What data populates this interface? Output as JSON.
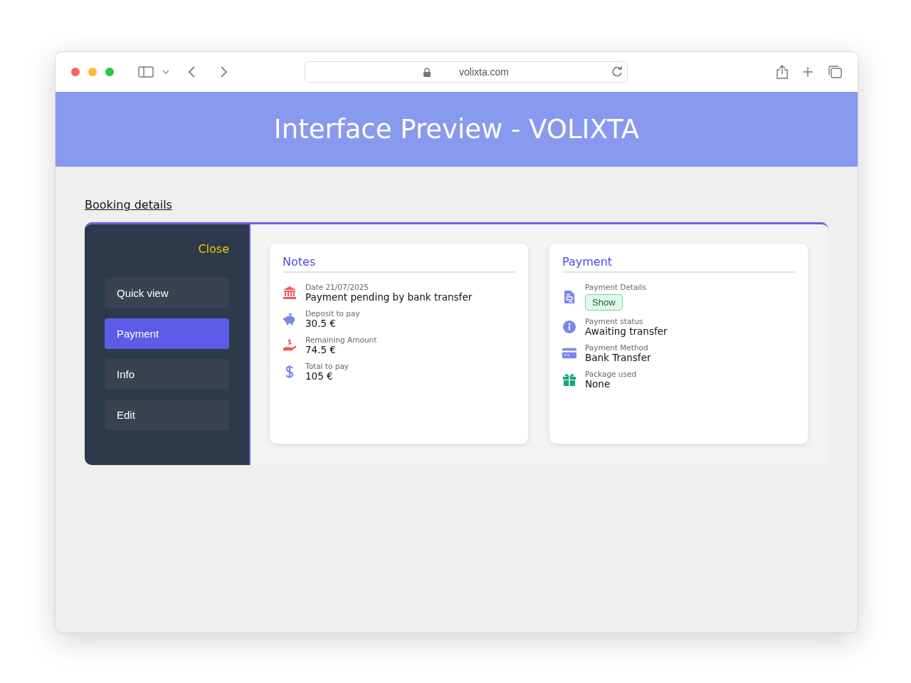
{
  "browser": {
    "url": "volixta.com"
  },
  "header": {
    "title": "Interface Preview - VOLIXTA"
  },
  "link": "Booking details",
  "sidebar": {
    "close": "Close",
    "items": [
      {
        "label": "Quick view",
        "selected": false
      },
      {
        "label": "Payment",
        "selected": true
      },
      {
        "label": "Info",
        "selected": false
      },
      {
        "label": "Edit",
        "selected": false
      }
    ]
  },
  "notes": {
    "title": "Notes",
    "items": [
      {
        "label": "Date 21/07/2025",
        "value": "Payment pending by bank transfer"
      },
      {
        "label": "Deposit to pay",
        "value": "30.5 €"
      },
      {
        "label": "Remaining Amount",
        "value": "74.5 €"
      },
      {
        "label": "Total to pay",
        "value": "105 €"
      }
    ]
  },
  "payment": {
    "title": "Payment",
    "items": [
      {
        "kind": "button",
        "label": "Payment Details",
        "value": "Show"
      },
      {
        "kind": "text",
        "label": "Payment status",
        "value": "Awaiting transfer"
      },
      {
        "kind": "text",
        "label": "Payment Method",
        "value": "Bank Transfer"
      },
      {
        "kind": "text",
        "label": "Package used",
        "value": "None"
      }
    ]
  }
}
